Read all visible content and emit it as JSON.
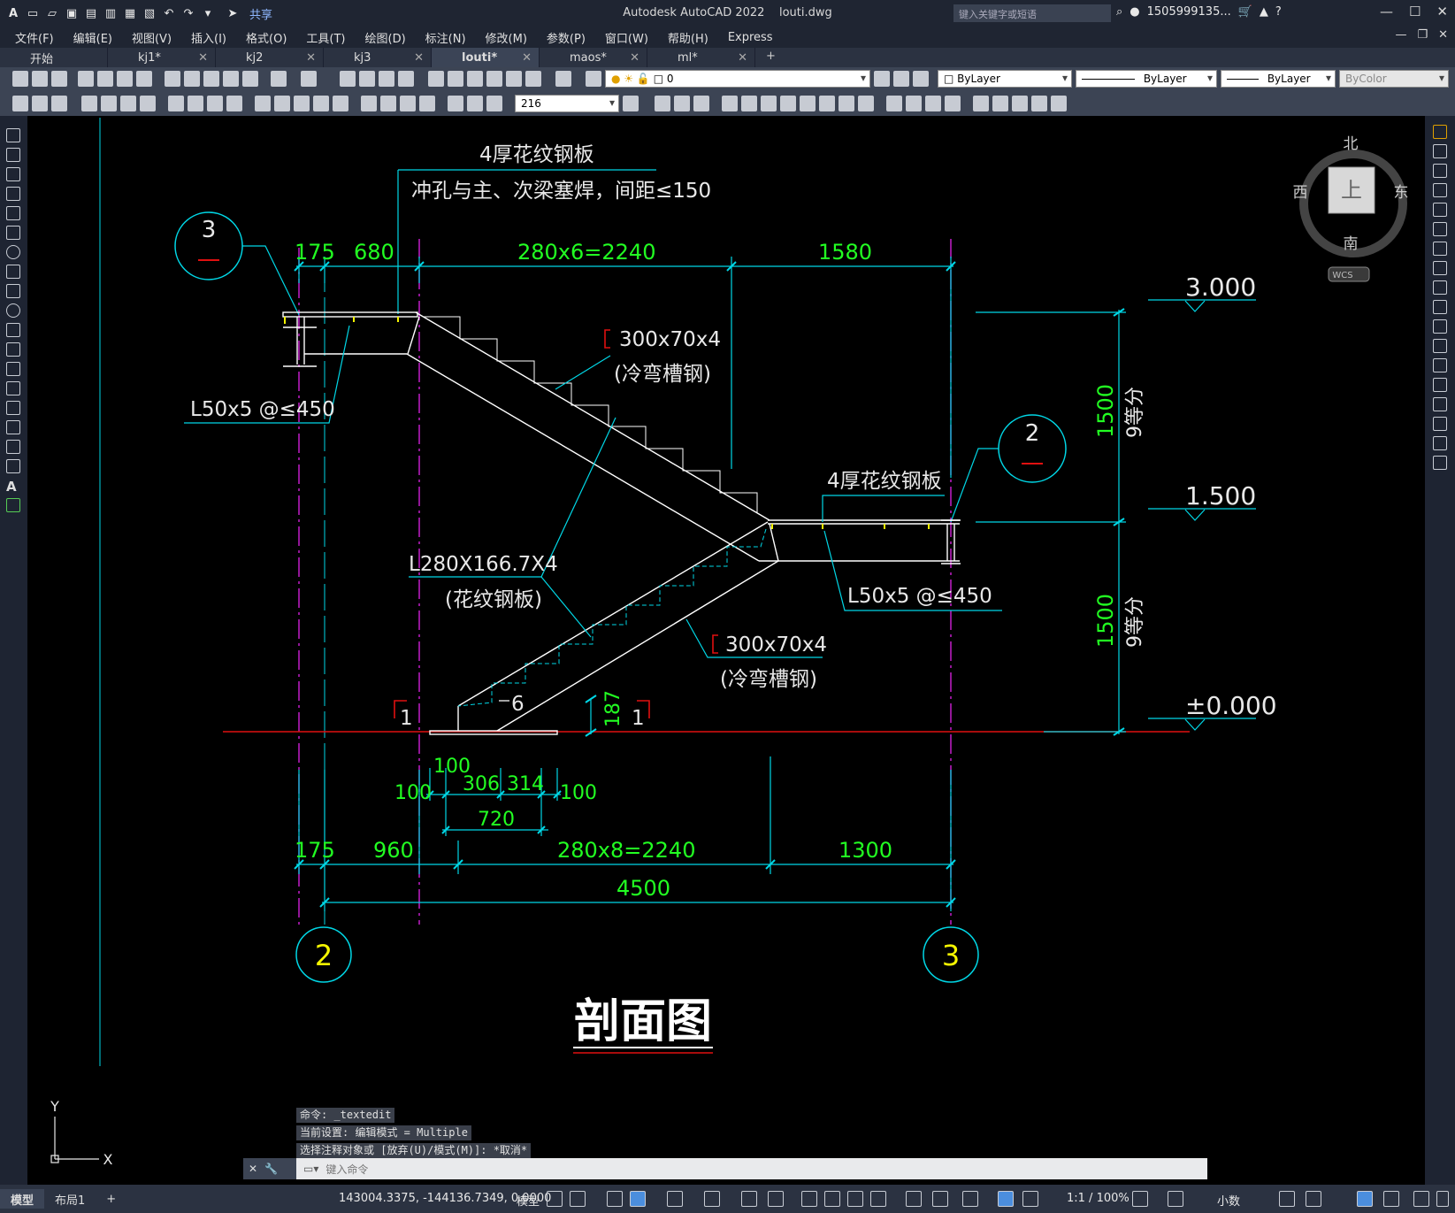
{
  "app": {
    "title": "Autodesk AutoCAD 2022",
    "document": "louti.dwg",
    "share_label": "共享",
    "search_placeholder": "键入关键字或短语",
    "user": "1505999135...",
    "logo_letter": "A"
  },
  "menu": {
    "items": [
      "文件(F)",
      "编辑(E)",
      "视图(V)",
      "插入(I)",
      "格式(O)",
      "工具(T)",
      "绘图(D)",
      "标注(N)",
      "修改(M)",
      "参数(P)",
      "窗口(W)",
      "帮助(H)",
      "Express"
    ]
  },
  "tabs": [
    {
      "label": "开始",
      "active": false
    },
    {
      "label": "kj1*",
      "active": false
    },
    {
      "label": "kj2",
      "active": false
    },
    {
      "label": "kj3",
      "active": false
    },
    {
      "label": "louti*",
      "active": true
    },
    {
      "label": "maos*",
      "active": false
    },
    {
      "label": "ml*",
      "active": false
    }
  ],
  "properties": {
    "layer": "0",
    "color": "ByLayer",
    "linetype": "ByLayer",
    "lineweight": "ByLayer",
    "plotstyle": "ByColor",
    "dimscale": "216"
  },
  "viewcube": {
    "north": "北",
    "south": "南",
    "east": "东",
    "west": "西",
    "top": "上",
    "wcs": "WCS"
  },
  "drawing": {
    "title": "剖面图",
    "notes": {
      "plate_top": "4厚花纹钢板",
      "weld_note": "冲孔与主、次梁塞焊，间距≤150",
      "channel_upper": "300x70x4",
      "channel_upper_note": "(冷弯槽钢)",
      "channel_lower": "300x70x4",
      "channel_lower_note": "(冷弯槽钢)",
      "angle_upper": "L50x5 @≤450",
      "angle_lower": "L50x5 @≤450",
      "plate_mid": "4厚花纹钢板",
      "tread": "L280X166.7X4",
      "tread_note": "(花纹钢板)",
      "cut_left": "1",
      "cut_right": "1",
      "weld_six": "6"
    },
    "top_dims": [
      "175",
      "680",
      "280x6=2240",
      "1580"
    ],
    "bottom_dims": [
      "175",
      "960",
      "280x8=2240",
      "1300"
    ],
    "total_dim": "4500",
    "base_dims": [
      "100",
      "100",
      "306",
      "314",
      "100",
      "720"
    ],
    "base_height": "187",
    "levels": [
      "3.000",
      "1.500",
      "±0.000"
    ],
    "vertical_dims": [
      "1500",
      "9等分",
      "1500",
      "9等分"
    ],
    "grid_bubbles": [
      "2",
      "3"
    ],
    "section_bubbles": [
      "3",
      "2"
    ]
  },
  "command": {
    "history": [
      "命令: _textedit",
      "当前设置: 编辑模式 = Multiple",
      "选择注释对象或 [放弃(U)/模式(M)]: *取消*"
    ],
    "placeholder": "键入命令"
  },
  "layout_tabs": [
    "模型",
    "布局1"
  ],
  "status": {
    "coords": "143004.3375, -144136.7349, 0.0000",
    "space": "模型",
    "scale": "1:1 / 100%",
    "units": "小数"
  },
  "ucs": {
    "x": "X",
    "y": "Y"
  },
  "colors": {
    "cyan": "#00d7e6",
    "green": "#22ff22",
    "magenta": "#d020d8",
    "red": "#e01010",
    "yellow": "#f5f500",
    "white": "#ffffff"
  }
}
